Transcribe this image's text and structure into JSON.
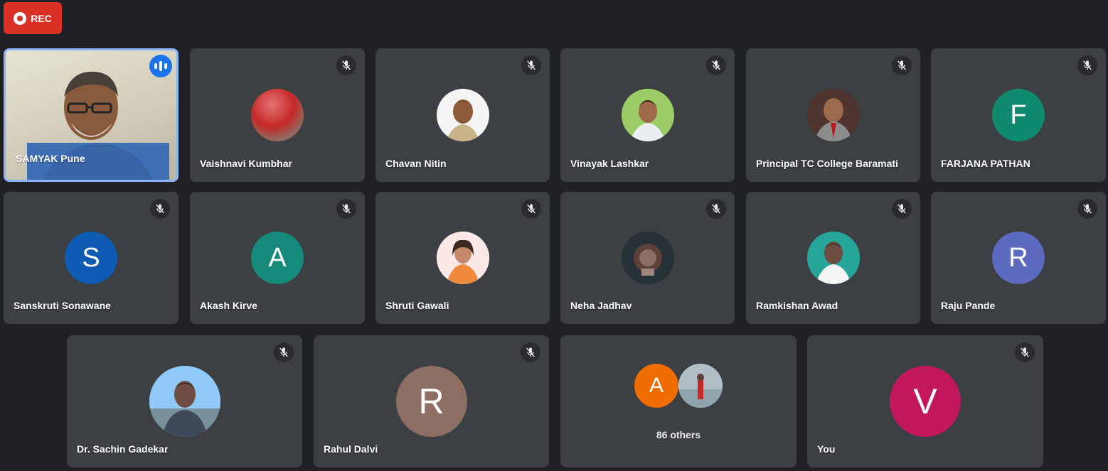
{
  "recording": {
    "label": "REC",
    "color": "#d93025"
  },
  "tiles": [
    {
      "name": "SAMYAK Pune",
      "speaking": true
    },
    {
      "name": "Vaishnavi Kumbhar",
      "avatar": "photo"
    },
    {
      "name": "Chavan Nitin",
      "avatar": "photo"
    },
    {
      "name": "Vinayak Lashkar",
      "avatar": "photo"
    },
    {
      "name": "Principal TC College Baramati",
      "avatar": "photo"
    },
    {
      "name": "FARJANA PATHAN",
      "letter": "F",
      "color": "#188038"
    },
    {
      "name": "Sanskruti Sonawane",
      "letter": "S",
      "color": "#1565c0"
    },
    {
      "name": "Akash Kirve",
      "letter": "A",
      "color": "#12897a"
    },
    {
      "name": "Shruti Gawali",
      "avatar": "photo"
    },
    {
      "name": "Neha Jadhav",
      "avatar": "photo"
    },
    {
      "name": "Ramkishan Awad",
      "avatar": "photo"
    },
    {
      "name": "Raju Pande",
      "letter": "R",
      "color": "#5c6bc0"
    },
    {
      "name": "Dr. Sachin Gadekar",
      "avatar": "photo"
    },
    {
      "name": "Rahul Dalvi",
      "letter": "R",
      "color": "#8d6e63"
    },
    {
      "others_label": "86 others",
      "letter": "A",
      "color": "#ef6c00"
    },
    {
      "name": "You",
      "letter": "V",
      "color": "#c2185b"
    }
  ],
  "icons": {
    "mute": "mic-off-icon",
    "speaking": "audio-bars-icon",
    "record": "record-dot-icon"
  }
}
